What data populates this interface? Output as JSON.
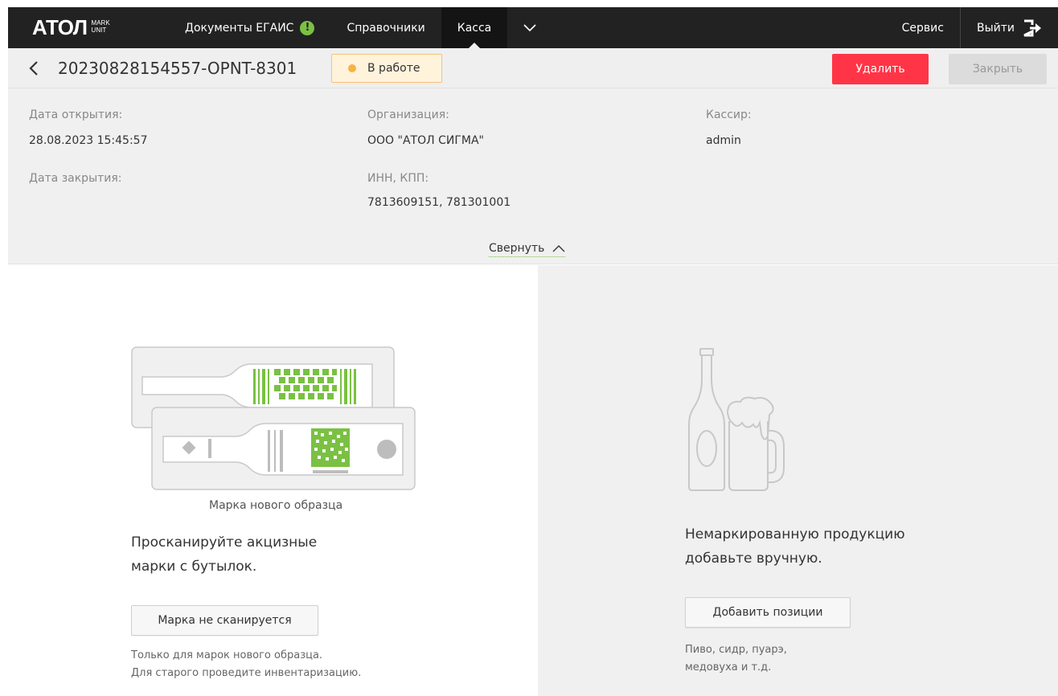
{
  "nav": {
    "logo": "АТОЛ",
    "logo_sub_1": "MARK",
    "logo_sub_2": "UNIT",
    "items": [
      {
        "label": "Документы ЕГАИС",
        "badge": "!"
      },
      {
        "label": "Справочники"
      },
      {
        "label": "Касса",
        "active": true
      }
    ],
    "service": "Сервис",
    "logout": "Выйти"
  },
  "document": {
    "title": "20230828154557-OPNT-8301",
    "status": "В работе",
    "delete_label": "Удалить",
    "close_label": "Закрыть"
  },
  "info": {
    "open_date_label": "Дата открытия:",
    "open_date": "28.08.2023 15:45:57",
    "close_date_label": "Дата закрытия:",
    "org_label": "Организация:",
    "org": "ООО \"АТОЛ СИГМА\"",
    "inn_label": "ИНН, КПП:",
    "inn": "7813609151, 781301001",
    "cashier_label": "Кассир:",
    "cashier": "admin",
    "collapse": "Свернуть"
  },
  "scan": {
    "caption": "Марка нового образца",
    "line1": "Просканируйте акцизные",
    "line2": "марки с бутылок.",
    "button": "Марка не сканируется",
    "note1": "Только для марок нового образца.",
    "note2": "Для старого проведите инвентаризацию."
  },
  "manual": {
    "line1": "Немаркированную продукцию",
    "line2": "добавьте вручную.",
    "button": "Добавить позиции",
    "note1": "Пиво, сидр, пуарэ,",
    "note2": "медовуха и т.д."
  },
  "colors": {
    "nav_bg": "#222222",
    "accent_green": "#7ac143",
    "danger": "#ff3547",
    "status_dot": "#f6b442"
  }
}
